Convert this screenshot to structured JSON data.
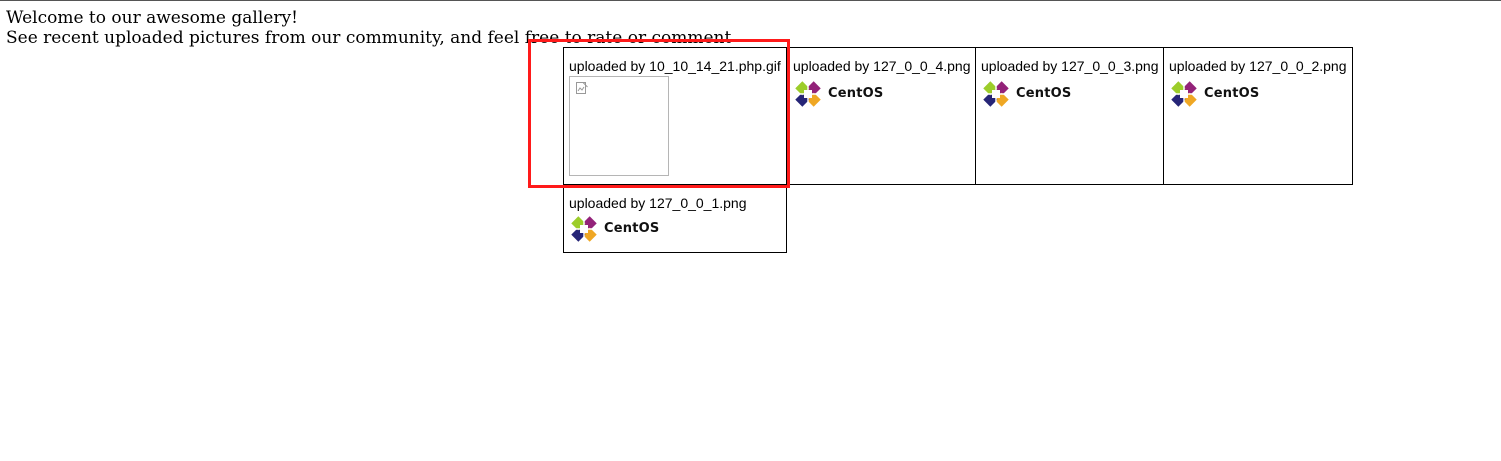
{
  "intro": {
    "line1": "Welcome to our awesome gallery!",
    "line2": "See recent uploaded pictures from our community, and feel free to rate or comment"
  },
  "gallery": [
    {
      "caption": "uploaded by 10_10_14_21.php.gif",
      "image": "broken-image-icon"
    },
    {
      "caption": "uploaded by 127_0_0_4.png",
      "image": "centos-logo",
      "logo_text": "CentOS"
    },
    {
      "caption": "uploaded by 127_0_0_3.png",
      "image": "centos-logo",
      "logo_text": "CentOS"
    },
    {
      "caption": "uploaded by 127_0_0_2.png",
      "image": "centos-logo",
      "logo_text": "CentOS"
    },
    {
      "caption": "uploaded by 127_0_0_1.png",
      "image": "centos-logo",
      "logo_text": "CentOS"
    }
  ],
  "colors": {
    "highlight": "#ff1a1a",
    "centos_purple": "#932279",
    "centos_yellow": "#efa724",
    "centos_blue": "#262577",
    "centos_green": "#9ccd2a"
  }
}
